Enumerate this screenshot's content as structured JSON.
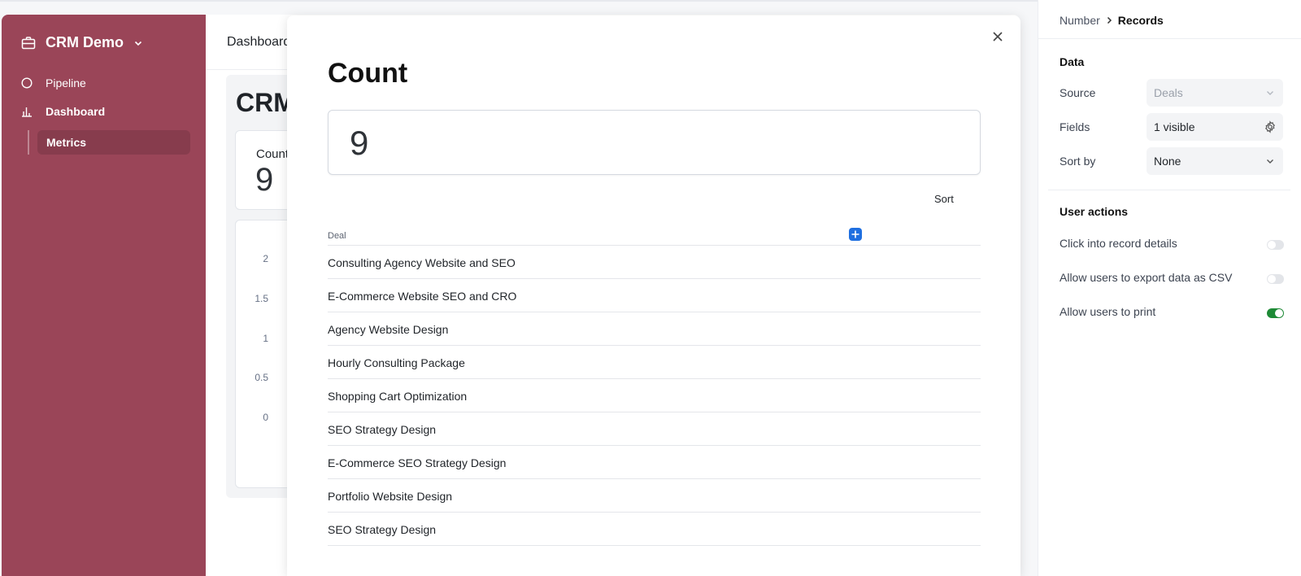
{
  "sidebar": {
    "app_name": "CRM Demo",
    "items": [
      {
        "label": "Pipeline",
        "icon": "circle-icon"
      },
      {
        "label": "Dashboard",
        "icon": "bar-chart-icon"
      }
    ],
    "subitems": [
      {
        "label": "Metrics"
      }
    ],
    "background_color": "#9a4558"
  },
  "main": {
    "breadcrumb": "Dashboard",
    "board_title": "CRM",
    "card_label": "Count",
    "card_value": "9",
    "y_ticks": [
      "2",
      "1.5",
      "1",
      "0.5",
      "0"
    ]
  },
  "modal": {
    "title": "Count",
    "value": "9",
    "sort_label": "Sort",
    "column_header": "Deal",
    "rows": [
      "Consulting Agency Website and SEO",
      "E-Commerce Website SEO and CRO",
      "Agency Website Design",
      "Hourly Consulting Package",
      "Shopping Cart Optimization",
      "SEO Strategy Design",
      "E-Commerce SEO Strategy Design",
      "Portfolio Website Design",
      "SEO Strategy Design"
    ]
  },
  "panel": {
    "breadcrumb_parent": "Number",
    "breadcrumb_current": "Records",
    "data_section": "Data",
    "source_label": "Source",
    "source_value": "Deals",
    "fields_label": "Fields",
    "fields_value": "1 visible",
    "sortby_label": "Sort by",
    "sortby_value": "None",
    "actions_section": "User actions",
    "actions": [
      {
        "label": "Click into record details",
        "enabled": false
      },
      {
        "label": "Allow users to export data as CSV",
        "enabled": false
      },
      {
        "label": "Allow users to print",
        "enabled": true
      }
    ],
    "toggle_on_color": "#1e8a36"
  }
}
